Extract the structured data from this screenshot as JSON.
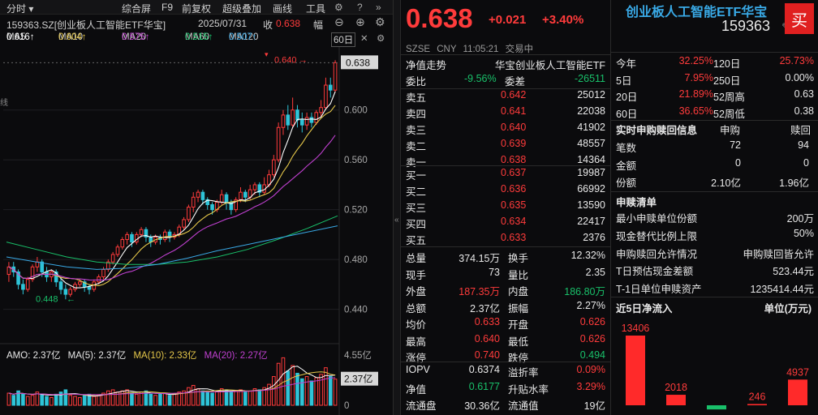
{
  "toolbar": {
    "period": "分时",
    "items": [
      "综合屏",
      "F9",
      "前复权",
      "超级叠加",
      "画线",
      "工具"
    ]
  },
  "header": {
    "code_name": "159363.SZ[创业板人工智能ETF华宝]",
    "date": "2025/07/31",
    "close_label": "收",
    "close_value": "0.638",
    "extra": "幅"
  },
  "ma_line": [
    {
      "label": "MA5",
      "value": "0.616↑",
      "color": "#ffffff"
    },
    {
      "label": "MA10",
      "value": "0.604↑",
      "color": "#e6c84a"
    },
    {
      "label": "MA20",
      "value": "0.575↑",
      "color": "#c040d0"
    },
    {
      "label": "MA60",
      "value": "0.515↑",
      "color": "#19c06a"
    },
    {
      "label": "MA120",
      "value": "0.507↑",
      "color": "#39a9e6"
    }
  ],
  "ma_end": "60日",
  "chart_data": {
    "type": "candlestick",
    "y_ticks": [
      "0.600",
      "0.560",
      "0.520",
      "0.480",
      "0.440"
    ],
    "ylim": [
      0.428,
      0.648
    ],
    "high_label": "0.640",
    "low_label": "0.448",
    "current_price_tag": "0.638",
    "candles": [
      [
        0.468,
        0.474,
        0.462,
        0.478
      ],
      [
        0.474,
        0.47,
        0.466,
        0.478
      ],
      [
        0.47,
        0.46,
        0.456,
        0.472
      ],
      [
        0.46,
        0.456,
        0.452,
        0.464
      ],
      [
        0.456,
        0.464,
        0.454,
        0.466
      ],
      [
        0.464,
        0.474,
        0.462,
        0.476
      ],
      [
        0.474,
        0.478,
        0.47,
        0.482
      ],
      [
        0.478,
        0.47,
        0.466,
        0.48
      ],
      [
        0.47,
        0.466,
        0.462,
        0.474
      ],
      [
        0.466,
        0.47,
        0.462,
        0.472
      ],
      [
        0.47,
        0.462,
        0.458,
        0.472
      ],
      [
        0.462,
        0.456,
        0.452,
        0.466
      ],
      [
        0.456,
        0.452,
        0.448,
        0.46
      ],
      [
        0.452,
        0.456,
        0.45,
        0.458
      ],
      [
        0.456,
        0.46,
        0.454,
        0.462
      ],
      [
        0.46,
        0.462,
        0.458,
        0.464
      ],
      [
        0.462,
        0.458,
        0.454,
        0.464
      ],
      [
        0.458,
        0.456,
        0.452,
        0.46
      ],
      [
        0.456,
        0.462,
        0.454,
        0.464
      ],
      [
        0.462,
        0.466,
        0.46,
        0.468
      ],
      [
        0.466,
        0.472,
        0.464,
        0.474
      ],
      [
        0.472,
        0.478,
        0.47,
        0.48
      ],
      [
        0.478,
        0.484,
        0.476,
        0.486
      ],
      [
        0.484,
        0.49,
        0.482,
        0.492
      ],
      [
        0.49,
        0.496,
        0.488,
        0.498
      ],
      [
        0.496,
        0.5,
        0.492,
        0.502
      ],
      [
        0.5,
        0.494,
        0.49,
        0.502
      ],
      [
        0.494,
        0.5,
        0.492,
        0.502
      ],
      [
        0.5,
        0.504,
        0.498,
        0.506
      ],
      [
        0.504,
        0.498,
        0.494,
        0.506
      ],
      [
        0.498,
        0.494,
        0.49,
        0.5
      ],
      [
        0.494,
        0.498,
        0.492,
        0.5
      ],
      [
        0.498,
        0.496,
        0.492,
        0.5
      ],
      [
        0.496,
        0.502,
        0.494,
        0.504
      ],
      [
        0.502,
        0.498,
        0.494,
        0.504
      ],
      [
        0.498,
        0.5,
        0.496,
        0.502
      ],
      [
        0.5,
        0.506,
        0.498,
        0.508
      ],
      [
        0.506,
        0.512,
        0.504,
        0.514
      ],
      [
        0.512,
        0.522,
        0.51,
        0.524
      ],
      [
        0.522,
        0.53,
        0.518,
        0.534
      ],
      [
        0.53,
        0.534,
        0.526,
        0.536
      ],
      [
        0.534,
        0.528,
        0.524,
        0.536
      ],
      [
        0.528,
        0.524,
        0.52,
        0.53
      ],
      [
        0.524,
        0.52,
        0.516,
        0.526
      ],
      [
        0.52,
        0.526,
        0.518,
        0.528
      ],
      [
        0.526,
        0.532,
        0.524,
        0.536
      ],
      [
        0.532,
        0.526,
        0.52,
        0.534
      ],
      [
        0.526,
        0.52,
        0.516,
        0.528
      ],
      [
        0.52,
        0.528,
        0.518,
        0.53
      ],
      [
        0.528,
        0.534,
        0.526,
        0.538
      ],
      [
        0.534,
        0.53,
        0.526,
        0.536
      ],
      [
        0.53,
        0.536,
        0.528,
        0.54
      ],
      [
        0.536,
        0.54,
        0.532,
        0.542
      ],
      [
        0.54,
        0.534,
        0.53,
        0.542
      ],
      [
        0.534,
        0.54,
        0.532,
        0.546
      ],
      [
        0.54,
        0.548,
        0.538,
        0.552
      ],
      [
        0.548,
        0.56,
        0.546,
        0.564
      ],
      [
        0.56,
        0.586,
        0.558,
        0.59
      ],
      [
        0.586,
        0.596,
        0.58,
        0.6
      ],
      [
        0.596,
        0.588,
        0.584,
        0.604
      ],
      [
        0.588,
        0.6,
        0.586,
        0.61
      ],
      [
        0.6,
        0.592,
        0.586,
        0.604
      ],
      [
        0.592,
        0.588,
        0.582,
        0.598
      ],
      [
        0.588,
        0.594,
        0.584,
        0.598
      ],
      [
        0.594,
        0.59,
        0.586,
        0.598
      ],
      [
        0.59,
        0.598,
        0.588,
        0.6
      ],
      [
        0.598,
        0.602,
        0.594,
        0.608
      ],
      [
        0.602,
        0.62,
        0.6,
        0.626
      ],
      [
        0.62,
        0.616,
        0.61,
        0.626
      ],
      [
        0.616,
        0.638,
        0.614,
        0.64
      ]
    ],
    "volume": {
      "ticks": [
        "4.55亿",
        "2.37亿",
        "0"
      ],
      "max": 4.55,
      "values": [
        1.1,
        0.9,
        1.3,
        1.0,
        0.8,
        0.9,
        1.2,
        1.0,
        0.8,
        0.7,
        1.0,
        1.2,
        1.4,
        0.9,
        0.8,
        0.7,
        0.9,
        1.0,
        0.8,
        0.9,
        1.1,
        1.3,
        1.4,
        1.2,
        1.3,
        1.4,
        1.1,
        1.0,
        1.2,
        1.3,
        1.0,
        0.9,
        1.0,
        1.1,
        0.9,
        1.0,
        1.2,
        1.3,
        1.6,
        1.8,
        1.5,
        1.3,
        1.2,
        1.1,
        1.3,
        1.5,
        1.4,
        1.2,
        1.3,
        1.4,
        1.2,
        1.3,
        1.5,
        1.4,
        1.6,
        1.9,
        2.6,
        3.8,
        4.3,
        3.1,
        3.6,
        2.9,
        2.4,
        2.6,
        2.2,
        2.5,
        2.8,
        3.4,
        2.6,
        2.37
      ]
    }
  },
  "amo_line": {
    "amo": "AMO: 2.37亿",
    "ma5": "MA(5): 2.37亿",
    "ma10": "MA(10): 2.33亿",
    "ma20": "MA(20): 2.27亿"
  },
  "volume_tag": "2.37亿",
  "quote": {
    "price": "0.638",
    "change": "+0.021",
    "change_pct": "+3.40%",
    "name": "创业板人工智能ETF华宝",
    "code": "159363",
    "market": "SZSE",
    "currency": "CNY",
    "time": "11:05:21",
    "status": "交易中",
    "nav_label": "净值走势",
    "nav_name": "华宝创业板人工智能ETF",
    "weibi_label": "委比",
    "weibi_value": "-9.56%",
    "weicha_label": "委差",
    "weicha_value": "-26511"
  },
  "asks": [
    {
      "label": "卖五",
      "price": "0.642",
      "vol": "25012"
    },
    {
      "label": "卖四",
      "price": "0.641",
      "vol": "22038"
    },
    {
      "label": "卖三",
      "price": "0.640",
      "vol": "41902"
    },
    {
      "label": "卖二",
      "price": "0.639",
      "vol": "48557"
    },
    {
      "label": "卖一",
      "price": "0.638",
      "vol": "14364"
    }
  ],
  "bids": [
    {
      "label": "买一",
      "price": "0.637",
      "vol": "19987"
    },
    {
      "label": "买二",
      "price": "0.636",
      "vol": "66992"
    },
    {
      "label": "买三",
      "price": "0.635",
      "vol": "13590"
    },
    {
      "label": "买四",
      "price": "0.634",
      "vol": "22417"
    },
    {
      "label": "买五",
      "price": "0.633",
      "vol": "2376"
    }
  ],
  "stats": [
    [
      {
        "l": "总量",
        "v": "374.15万",
        "c": "w"
      },
      {
        "l": "换手",
        "v": "12.32%",
        "c": "w"
      }
    ],
    [
      {
        "l": "现手",
        "v": "73",
        "c": "w"
      },
      {
        "l": "量比",
        "v": "2.35",
        "c": "w"
      }
    ],
    [
      {
        "l": "外盘",
        "v": "187.35万",
        "c": "red"
      },
      {
        "l": "内盘",
        "v": "186.80万",
        "c": "green"
      }
    ],
    [
      {
        "l": "总额",
        "v": "2.37亿",
        "c": "w"
      },
      {
        "l": "振幅",
        "v": "2.27%",
        "c": "w"
      }
    ],
    [
      {
        "l": "均价",
        "v": "0.633",
        "c": "red"
      },
      {
        "l": "开盘",
        "v": "0.626",
        "c": "red"
      }
    ],
    [
      {
        "l": "最高",
        "v": "0.640",
        "c": "red"
      },
      {
        "l": "最低",
        "v": "0.626",
        "c": "red"
      }
    ],
    [
      {
        "l": "涨停",
        "v": "0.740",
        "c": "red"
      },
      {
        "l": "跌停",
        "v": "0.494",
        "c": "green"
      }
    ]
  ],
  "stats2": [
    [
      {
        "l": "IOPV",
        "v": "0.6374",
        "c": "w"
      },
      {
        "l": "溢折率",
        "v": "0.09%",
        "c": "red"
      }
    ],
    [
      {
        "l": "净值",
        "v": "0.6177",
        "c": "green"
      },
      {
        "l": "升贴水率",
        "v": "3.29%",
        "c": "red"
      }
    ],
    [
      {
        "l": "流通盘",
        "v": "30.36亿",
        "c": "w"
      },
      {
        "l": "流通值",
        "v": "19亿",
        "c": "w"
      }
    ]
  ],
  "info": {
    "buy_button": "买",
    "perf": [
      [
        {
          "l": "今年",
          "v": "32.25%",
          "c": "red"
        },
        {
          "l": "120日",
          "v": "25.73%",
          "c": "red"
        }
      ],
      [
        {
          "l": "5日",
          "v": "7.95%",
          "c": "red"
        },
        {
          "l": "250日",
          "v": "0.00%",
          "c": "w"
        }
      ],
      [
        {
          "l": "20日",
          "v": "21.89%",
          "c": "red"
        },
        {
          "l": "52周高",
          "v": "0.63",
          "c": "w"
        }
      ],
      [
        {
          "l": "60日",
          "v": "36.65%",
          "c": "red"
        },
        {
          "l": "52周低",
          "v": "0.38",
          "c": "w"
        }
      ]
    ],
    "sub_title": "实时申购赎回信息",
    "sub_col1": "申购",
    "sub_col2": "赎回",
    "sub_rows": [
      {
        "l": "笔数",
        "a": "72",
        "b": "94"
      },
      {
        "l": "金额",
        "a": "0",
        "b": "0"
      },
      {
        "l": "份额",
        "a": "2.10亿",
        "b": "1.96亿"
      }
    ],
    "list_title": "申赎清单",
    "list_rows": [
      {
        "l": "最小申赎单位份额",
        "v": "200万"
      },
      {
        "l": "现金替代比例上限",
        "v": "50%"
      },
      {
        "l": "申购赎回允许情况",
        "v": "申购赎回皆允许"
      },
      {
        "l": "T日预估现金差额",
        "v": "523.44元"
      },
      {
        "l": "T-1日单位申赎资产",
        "v": "1235414.44元"
      }
    ],
    "flow_title": "近5日净流入",
    "flow_unit": "单位(万元)",
    "flow_values": [
      13406,
      2018,
      -800,
      246,
      4937
    ],
    "flow_labels": [
      "13406",
      "2018",
      "",
      "246",
      "4937"
    ]
  }
}
